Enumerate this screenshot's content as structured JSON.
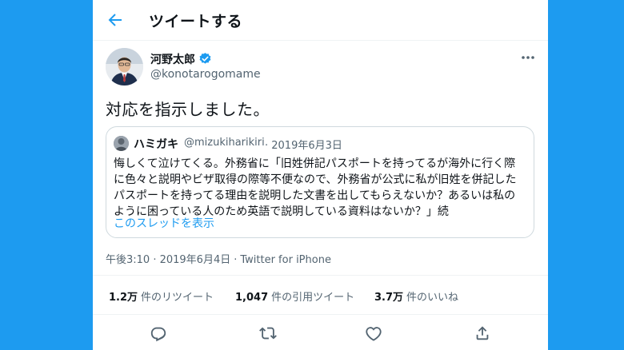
{
  "colors": {
    "accent": "#1d9bf0",
    "text": "#0f1419",
    "muted": "#536471",
    "border": "#cfd9de"
  },
  "header": {
    "back_icon": "arrow-left-icon",
    "title": "ツイートする"
  },
  "author": {
    "name": "河野太郎",
    "handle": "@konotarogomame",
    "verified": true
  },
  "tweet": {
    "text": "対応を指示しました。"
  },
  "quote": {
    "name": "ハミガキ",
    "handle": "@mizukiharikiri",
    "date": "· 2019年6月3日",
    "lines": [
      "悔しくて泣けてくる。外務省に「旧姓併記パスポートを持ってるが海外に行く際",
      "に色々と説明やビザ取得の際等不便なので、外務省が公式に私が旧姓を併記した",
      "パスポートを持ってる理由を説明した文書を出してもらえないか？あるいは私の",
      "ように困っている人のため英語で説明している資料はないか？」続"
    ],
    "thread_link": "このスレッドを表示"
  },
  "meta": {
    "time": "午後3:10 · 2019年6月4日",
    "separator": "·",
    "client": "Twitter for iPhone"
  },
  "stats": {
    "retweets_count": "1.2万",
    "retweets_label": "件のリツイート",
    "quotes_count": "1,047",
    "quotes_label": "件の引用ツイート",
    "likes_count": "3.7万",
    "likes_label": "件のいいね"
  },
  "actions": [
    "reply-icon",
    "retweet-icon",
    "like-icon",
    "share-icon"
  ]
}
